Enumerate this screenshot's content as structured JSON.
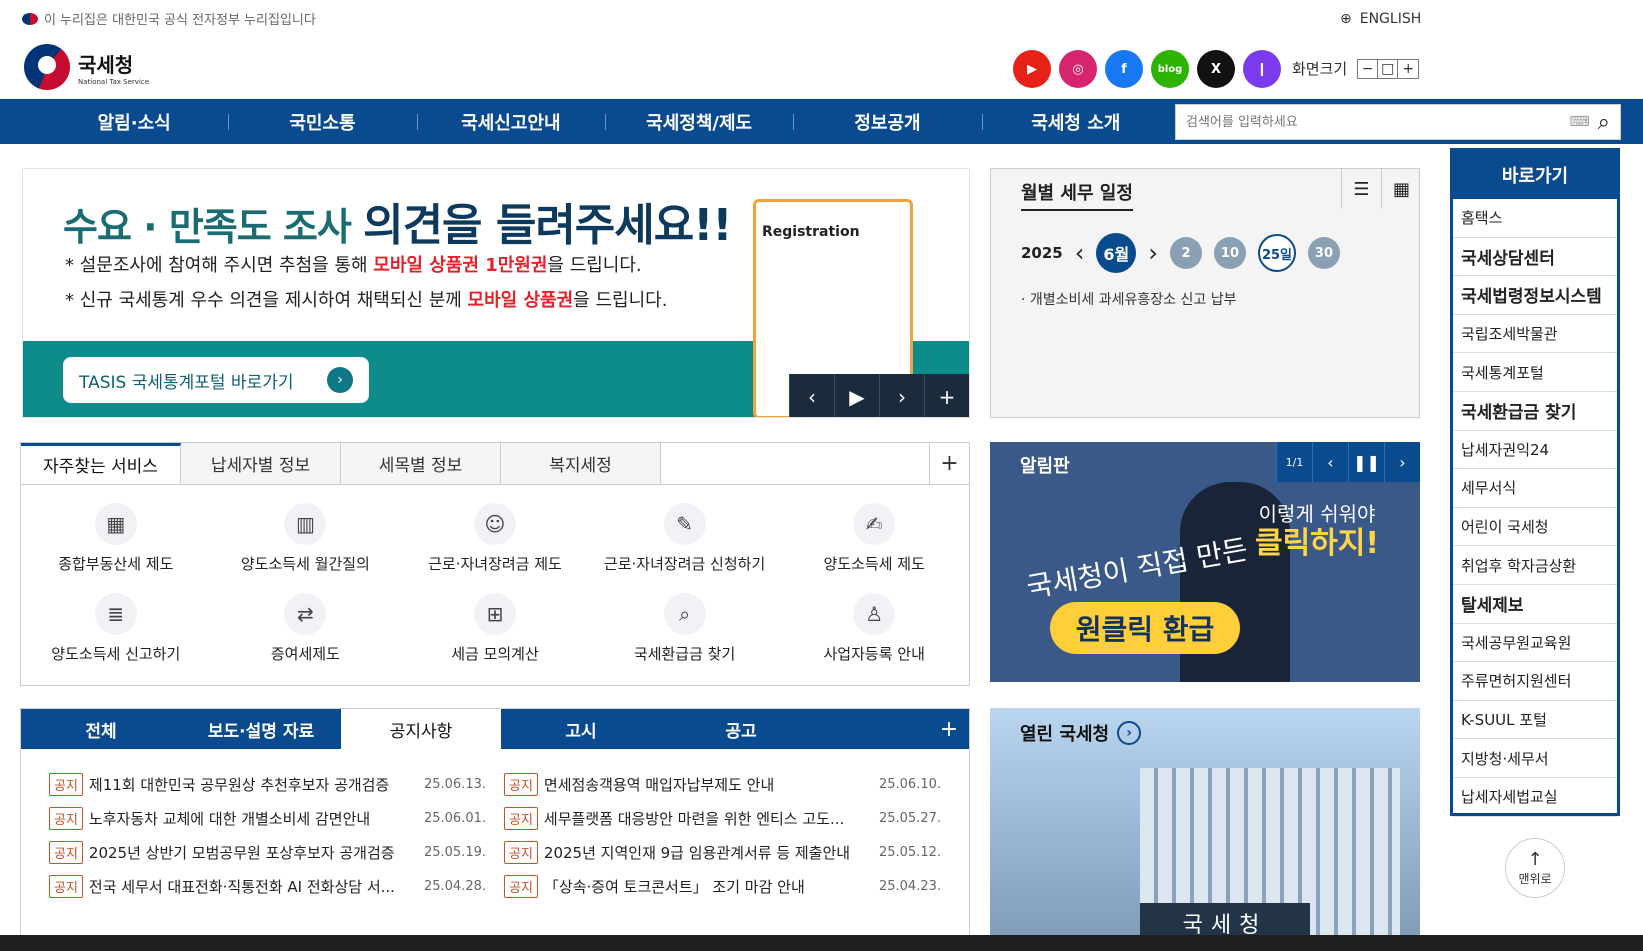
{
  "gov_notice": "이 누리집은 대한민국 공식 전자정부 누리집입니다",
  "lang_link": "ENGLISH",
  "logo": {
    "name": "국세청",
    "sub": "National Tax Service"
  },
  "social": [
    {
      "name": "youtube-icon",
      "color": "#e62117",
      "glyph": "▶"
    },
    {
      "name": "instagram-icon",
      "color": "#d6246e",
      "glyph": "◎"
    },
    {
      "name": "facebook-icon",
      "color": "#1877f2",
      "glyph": "f"
    },
    {
      "name": "blog-icon",
      "color": "#2db400",
      "glyph": "blog"
    },
    {
      "name": "x-icon",
      "color": "#111111",
      "glyph": "X"
    },
    {
      "name": "talk-icon",
      "color": "#7c3aed",
      "glyph": "❙"
    }
  ],
  "zoom": {
    "label": "화면크기",
    "minus": "−",
    "reset": "□",
    "plus": "+"
  },
  "nav": [
    "알림·소식",
    "국민소통",
    "국세신고안내",
    "국세정책/제도",
    "정보공개",
    "국세청 소개"
  ],
  "search": {
    "placeholder": "검색어를 입력하세요"
  },
  "banner": {
    "title_a": "수요 · 만족도 조사",
    "title_b": "의견을 들려주세요!!",
    "line1_a": "* 설문조사에 참여해 주시면 추첨을 통해 ",
    "line1_em": "모바일 상품권 1만원권",
    "line1_b": "을 드립니다.",
    "line2_a": "* 신규 국세통계 우수 의견을 제시하여 채택되신 분께 ",
    "line2_em": "모바일 상품권",
    "line2_b": "을 드립니다.",
    "cta": "TASIS 국세통계포털 바로가기",
    "clip": "Registration"
  },
  "schedule": {
    "title": "월별 세무 일정",
    "year": "2025",
    "month": "6월",
    "days": [
      "2",
      "10",
      "25일",
      "30"
    ],
    "item": "· 개별소비세 과세유흥장소 신고 납부"
  },
  "services": {
    "tabs": [
      "자주찾는 서비스",
      "납세자별 정보",
      "세목별 정보",
      "복지세정"
    ],
    "items": [
      {
        "label": "종합부동산세 제도",
        "icon": "▦"
      },
      {
        "label": "양도소득세 월간질의",
        "icon": "▥"
      },
      {
        "label": "근로·자녀장려금 제도",
        "icon": "☺"
      },
      {
        "label": "근로·자녀장려금 신청하기",
        "icon": "✎"
      },
      {
        "label": "양도소득세 제도",
        "icon": "✍"
      },
      {
        "label": "양도소득세 신고하기",
        "icon": "≣"
      },
      {
        "label": "증여세제도",
        "icon": "⇄"
      },
      {
        "label": "세금 모의계산",
        "icon": "⊞"
      },
      {
        "label": "국세환급금 찾기",
        "icon": "⌕"
      },
      {
        "label": "사업자등록 안내",
        "icon": "♙"
      }
    ]
  },
  "board": {
    "title": "알림판",
    "page": "1/1",
    "msg_a": "이렇게 쉬워야",
    "msg_b": "클릭하지!",
    "hand": "국세청이 직접 만든",
    "pill": "원클릭 환급"
  },
  "news": {
    "tabs": [
      "전체",
      "보도·설명 자료",
      "공지사항",
      "고시",
      "공고"
    ],
    "tag": "공지",
    "rows": [
      {
        "t": "제11회 대한민국 공무원상 추천후보자 공개검증",
        "d": "25.06.13."
      },
      {
        "t": "면세점송객용역 매입자납부제도 안내",
        "d": "25.06.10."
      },
      {
        "t": "노후자동차 교체에 대한 개별소비세 감면안내",
        "d": "25.06.01."
      },
      {
        "t": "세무플랫폼 대응방안 마련을 위한 엔티스 고도...",
        "d": "25.05.27."
      },
      {
        "t": "2025년 상반기 모범공무원 포상후보자 공개검증",
        "d": "25.05.19."
      },
      {
        "t": "2025년 지역인재 9급 임용관계서류 등 제출안내",
        "d": "25.05.12."
      },
      {
        "t": "전국 세무서 대표전화·직통전화 AI 전화상담 서...",
        "d": "25.04.28."
      },
      {
        "t": "「상속·증여 토크콘서트」 조기 마감 안내",
        "d": "25.04.23."
      }
    ]
  },
  "open": {
    "title": "열린 국세청",
    "sign": "국세청"
  },
  "sidebar": {
    "title": "바로가기",
    "items": [
      {
        "t": "홈택스",
        "big": false
      },
      {
        "t": "국세상담센터",
        "big": true
      },
      {
        "t": "국세법령정보시스템",
        "big": true
      },
      {
        "t": "국립조세박물관",
        "big": false
      },
      {
        "t": "국세통계포털",
        "big": false
      },
      {
        "t": "국세환급금 찾기",
        "big": true
      },
      {
        "t": "납세자권익24",
        "big": false
      },
      {
        "t": "세무서식",
        "big": false
      },
      {
        "t": "어린이 국세청",
        "big": false
      },
      {
        "t": "취업후 학자금상환",
        "big": false
      },
      {
        "t": "탈세제보",
        "big": true
      },
      {
        "t": "국세공무원교육원",
        "big": false
      },
      {
        "t": "주류면허지원센터",
        "big": false
      },
      {
        "t": "K-SUUL 포털",
        "big": false
      },
      {
        "t": "지방청·세무서",
        "big": false
      },
      {
        "t": "납세자세법교실",
        "big": false
      }
    ]
  },
  "top_btn": "맨위로"
}
